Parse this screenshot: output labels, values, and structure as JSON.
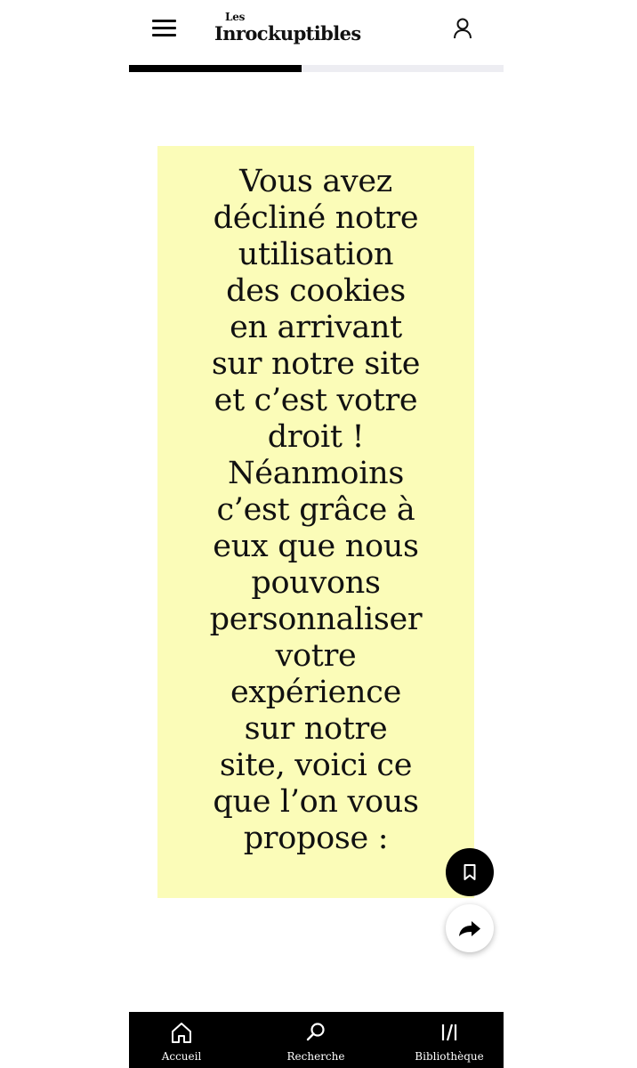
{
  "header": {
    "logo_small": "Les",
    "logo_main": "Inrockuptibles",
    "icons": {
      "menu": "hamburger-menu-icon",
      "account": "user-account-icon"
    }
  },
  "reading_progress": {
    "fraction": 0.46
  },
  "notice": {
    "text": "Vous avez\ndécliné notre\nutilisation\ndes cookies\nen arrivant\nsur notre site\net c’est votre\ndroit !\nNéanmoins\nc’est grâce à\neux que nous\npouvons\npersonnaliser\nvotre\nexpérience\nsur notre\nsite, voici ce\nque l’on vous\npropose :",
    "background": "#fbfcb8"
  },
  "actions": {
    "bookmark_icon": "bookmark-icon",
    "share_icon": "share-arrow-icon"
  },
  "bottom_nav": {
    "items": [
      {
        "label": "Accueil",
        "icon": "home-icon"
      },
      {
        "label": "Recherche",
        "icon": "search-icon"
      },
      {
        "label": "Bibliothèque",
        "icon": "library-icon"
      }
    ]
  },
  "colors": {
    "primary": "#000000",
    "highlight": "#fbfcb8",
    "progress_track": "#ededf2"
  }
}
